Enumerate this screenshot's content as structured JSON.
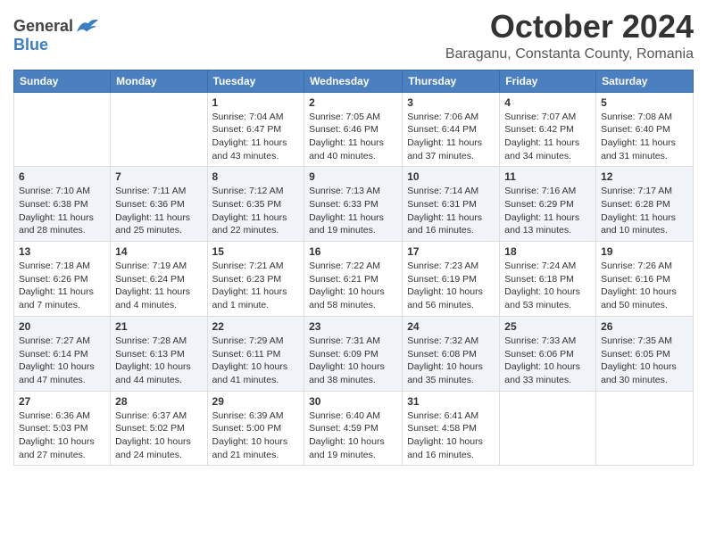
{
  "header": {
    "logo_general": "General",
    "logo_blue": "Blue",
    "month": "October 2024",
    "location": "Baraganu, Constanta County, Romania"
  },
  "days_of_week": [
    "Sunday",
    "Monday",
    "Tuesday",
    "Wednesday",
    "Thursday",
    "Friday",
    "Saturday"
  ],
  "weeks": [
    [
      {
        "day": "",
        "info": ""
      },
      {
        "day": "",
        "info": ""
      },
      {
        "day": "1",
        "info": "Sunrise: 7:04 AM\nSunset: 6:47 PM\nDaylight: 11 hours\nand 43 minutes."
      },
      {
        "day": "2",
        "info": "Sunrise: 7:05 AM\nSunset: 6:46 PM\nDaylight: 11 hours\nand 40 minutes."
      },
      {
        "day": "3",
        "info": "Sunrise: 7:06 AM\nSunset: 6:44 PM\nDaylight: 11 hours\nand 37 minutes."
      },
      {
        "day": "4",
        "info": "Sunrise: 7:07 AM\nSunset: 6:42 PM\nDaylight: 11 hours\nand 34 minutes."
      },
      {
        "day": "5",
        "info": "Sunrise: 7:08 AM\nSunset: 6:40 PM\nDaylight: 11 hours\nand 31 minutes."
      }
    ],
    [
      {
        "day": "6",
        "info": "Sunrise: 7:10 AM\nSunset: 6:38 PM\nDaylight: 11 hours\nand 28 minutes."
      },
      {
        "day": "7",
        "info": "Sunrise: 7:11 AM\nSunset: 6:36 PM\nDaylight: 11 hours\nand 25 minutes."
      },
      {
        "day": "8",
        "info": "Sunrise: 7:12 AM\nSunset: 6:35 PM\nDaylight: 11 hours\nand 22 minutes."
      },
      {
        "day": "9",
        "info": "Sunrise: 7:13 AM\nSunset: 6:33 PM\nDaylight: 11 hours\nand 19 minutes."
      },
      {
        "day": "10",
        "info": "Sunrise: 7:14 AM\nSunset: 6:31 PM\nDaylight: 11 hours\nand 16 minutes."
      },
      {
        "day": "11",
        "info": "Sunrise: 7:16 AM\nSunset: 6:29 PM\nDaylight: 11 hours\nand 13 minutes."
      },
      {
        "day": "12",
        "info": "Sunrise: 7:17 AM\nSunset: 6:28 PM\nDaylight: 11 hours\nand 10 minutes."
      }
    ],
    [
      {
        "day": "13",
        "info": "Sunrise: 7:18 AM\nSunset: 6:26 PM\nDaylight: 11 hours\nand 7 minutes."
      },
      {
        "day": "14",
        "info": "Sunrise: 7:19 AM\nSunset: 6:24 PM\nDaylight: 11 hours\nand 4 minutes."
      },
      {
        "day": "15",
        "info": "Sunrise: 7:21 AM\nSunset: 6:23 PM\nDaylight: 11 hours\nand 1 minute."
      },
      {
        "day": "16",
        "info": "Sunrise: 7:22 AM\nSunset: 6:21 PM\nDaylight: 10 hours\nand 58 minutes."
      },
      {
        "day": "17",
        "info": "Sunrise: 7:23 AM\nSunset: 6:19 PM\nDaylight: 10 hours\nand 56 minutes."
      },
      {
        "day": "18",
        "info": "Sunrise: 7:24 AM\nSunset: 6:18 PM\nDaylight: 10 hours\nand 53 minutes."
      },
      {
        "day": "19",
        "info": "Sunrise: 7:26 AM\nSunset: 6:16 PM\nDaylight: 10 hours\nand 50 minutes."
      }
    ],
    [
      {
        "day": "20",
        "info": "Sunrise: 7:27 AM\nSunset: 6:14 PM\nDaylight: 10 hours\nand 47 minutes."
      },
      {
        "day": "21",
        "info": "Sunrise: 7:28 AM\nSunset: 6:13 PM\nDaylight: 10 hours\nand 44 minutes."
      },
      {
        "day": "22",
        "info": "Sunrise: 7:29 AM\nSunset: 6:11 PM\nDaylight: 10 hours\nand 41 minutes."
      },
      {
        "day": "23",
        "info": "Sunrise: 7:31 AM\nSunset: 6:09 PM\nDaylight: 10 hours\nand 38 minutes."
      },
      {
        "day": "24",
        "info": "Sunrise: 7:32 AM\nSunset: 6:08 PM\nDaylight: 10 hours\nand 35 minutes."
      },
      {
        "day": "25",
        "info": "Sunrise: 7:33 AM\nSunset: 6:06 PM\nDaylight: 10 hours\nand 33 minutes."
      },
      {
        "day": "26",
        "info": "Sunrise: 7:35 AM\nSunset: 6:05 PM\nDaylight: 10 hours\nand 30 minutes."
      }
    ],
    [
      {
        "day": "27",
        "info": "Sunrise: 6:36 AM\nSunset: 5:03 PM\nDaylight: 10 hours\nand 27 minutes."
      },
      {
        "day": "28",
        "info": "Sunrise: 6:37 AM\nSunset: 5:02 PM\nDaylight: 10 hours\nand 24 minutes."
      },
      {
        "day": "29",
        "info": "Sunrise: 6:39 AM\nSunset: 5:00 PM\nDaylight: 10 hours\nand 21 minutes."
      },
      {
        "day": "30",
        "info": "Sunrise: 6:40 AM\nSunset: 4:59 PM\nDaylight: 10 hours\nand 19 minutes."
      },
      {
        "day": "31",
        "info": "Sunrise: 6:41 AM\nSunset: 4:58 PM\nDaylight: 10 hours\nand 16 minutes."
      },
      {
        "day": "",
        "info": ""
      },
      {
        "day": "",
        "info": ""
      }
    ]
  ]
}
